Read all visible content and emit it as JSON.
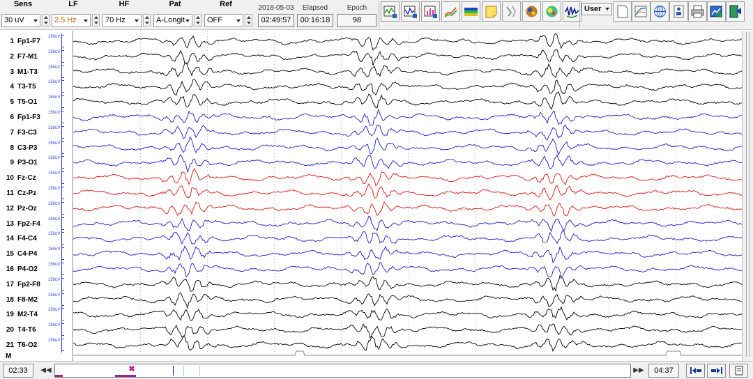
{
  "toolbar": {
    "sens": {
      "label": "Sens",
      "value": "30 uV"
    },
    "lf": {
      "label": "LF",
      "value": "2.5 Hz"
    },
    "hf": {
      "label": "HF",
      "value": "70 Hz"
    },
    "pat": {
      "label": "Pat",
      "value": "A-Longit"
    },
    "ref": {
      "label": "Ref",
      "value": "OFF"
    },
    "date": "2018-05-03",
    "clock": "02:49:57",
    "elapsed_label": "Elapsed",
    "elapsed": "00:16:18",
    "epoch_label": "Epoch",
    "epoch": "98",
    "user_label": "User",
    "tool_icons": [
      "montage-icon",
      "spectrum-icon",
      "bar-chart-icon",
      "trend-icon",
      "color-map-icon",
      "note-icon",
      "annotation-icon",
      "head-map-icon",
      "topography-icon",
      "wave-detect-icon"
    ],
    "right_icons": [
      "blank-page-icon",
      "curve-icon",
      "sphere-grid-icon",
      "patient-icon",
      "print-icon",
      "export-icon",
      "exit-icon"
    ]
  },
  "channels": [
    {
      "num": "1",
      "name": "Fp1-F7",
      "scale": "150uV",
      "color": "#000000"
    },
    {
      "num": "2",
      "name": "F7-M1",
      "scale": "150uV",
      "color": "#000000"
    },
    {
      "num": "3",
      "name": "M1-T3",
      "scale": "150uV",
      "color": "#000000"
    },
    {
      "num": "4",
      "name": "T3-T5",
      "scale": "150uV",
      "color": "#000000"
    },
    {
      "num": "5",
      "name": "T5-O1",
      "scale": "150uV",
      "color": "#000000"
    },
    {
      "num": "6",
      "name": "Fp1-F3",
      "scale": "150uV",
      "color": "#1a1ad0"
    },
    {
      "num": "7",
      "name": "F3-C3",
      "scale": "150uV",
      "color": "#1a1ad0"
    },
    {
      "num": "8",
      "name": "C3-P3",
      "scale": "150uV",
      "color": "#1a1ad0"
    },
    {
      "num": "9",
      "name": "P3-O1",
      "scale": "150uV",
      "color": "#1a1ad0"
    },
    {
      "num": "10",
      "name": "Fz-Cz",
      "scale": "150uV",
      "color": "#e01010"
    },
    {
      "num": "11",
      "name": "Cz-Pz",
      "scale": "150uV",
      "color": "#e01010"
    },
    {
      "num": "12",
      "name": "Pz-Oz",
      "scale": "150uV",
      "color": "#e01010"
    },
    {
      "num": "13",
      "name": "Fp2-F4",
      "scale": "150uV",
      "color": "#1a1ad0"
    },
    {
      "num": "14",
      "name": "F4-C4",
      "scale": "150uV",
      "color": "#1a1ad0"
    },
    {
      "num": "15",
      "name": "C4-P4",
      "scale": "150uV",
      "color": "#1a1ad0"
    },
    {
      "num": "16",
      "name": "P4-O2",
      "scale": "150uV",
      "color": "#1a1ad0"
    },
    {
      "num": "17",
      "name": "Fp2-F8",
      "scale": "150uV",
      "color": "#000000"
    },
    {
      "num": "18",
      "name": "F8-M2",
      "scale": "150uV",
      "color": "#000000"
    },
    {
      "num": "19",
      "name": "M2-T4",
      "scale": "150uV",
      "color": "#000000"
    },
    {
      "num": "20",
      "name": "T4-T6",
      "scale": "150uV",
      "color": "#000000"
    },
    {
      "num": "21",
      "name": "T6-O2",
      "scale": "150uV",
      "color": "#000000"
    }
  ],
  "marker_row": "M",
  "grid_color": "#b8b8b8",
  "bottom": {
    "start_time": "02:33",
    "end_time": "04:37",
    "prev_icon": "rewind-icon",
    "next_icon": "fast-forward-icon",
    "timeline_cursor": "x-marker-icon"
  }
}
